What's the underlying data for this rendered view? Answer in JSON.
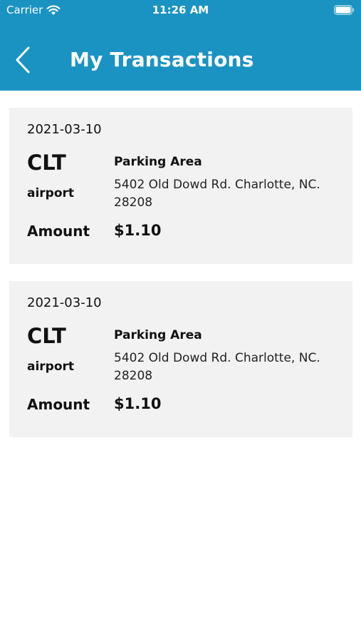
{
  "status_bar": {
    "carrier": "Carrier",
    "time": "11:26 AM"
  },
  "header": {
    "title": "My Transactions",
    "back_icon": "chevron-left-icon",
    "color": "#1a93c2"
  },
  "transactions": [
    {
      "date": "2021-03-10",
      "code": "CLT",
      "type": "airport",
      "area": "Parking Area",
      "address": "5402 Old Dowd Rd. Charlotte, NC. 28208",
      "amount_label": "Amount",
      "amount": "$1.10"
    },
    {
      "date": "2021-03-10",
      "code": "CLT",
      "type": "airport",
      "area": "Parking Area",
      "address": "5402 Old Dowd Rd. Charlotte, NC. 28208",
      "amount_label": "Amount",
      "amount": "$1.10"
    }
  ]
}
